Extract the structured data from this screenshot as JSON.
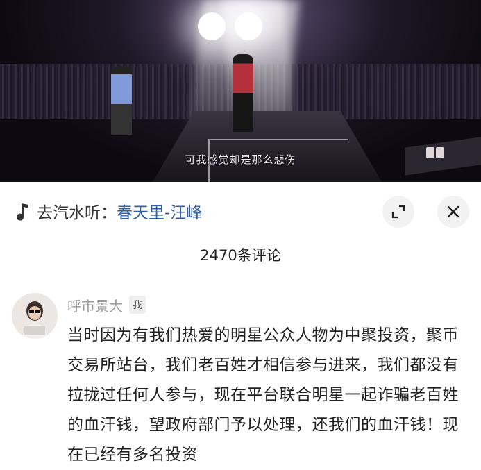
{
  "video": {
    "subtitle": "可我感觉却是那么悲伤"
  },
  "music": {
    "prefix": "去汽水听：",
    "song": "春天里-汪峰"
  },
  "comments_header": {
    "count_label": "2470条评论"
  },
  "comment": {
    "author": "呼市景大",
    "badge": "我",
    "text": "当时因为有我们热爱的明星公众人物为中聚投资，聚币交易所站台，我们老百姓才相信参与进来，我们都没有拉拢过任何人参与，现在平台联合明星一起诈骗老百姓的血汗钱，望政府部门予以处理，还我们的血汗钱！现在已经有多名投资"
  },
  "icons": {
    "music": "music-note-icon",
    "expand": "expand-icon",
    "close": "close-icon"
  },
  "colors": {
    "link": "#2f5fa6",
    "author": "#999999"
  }
}
